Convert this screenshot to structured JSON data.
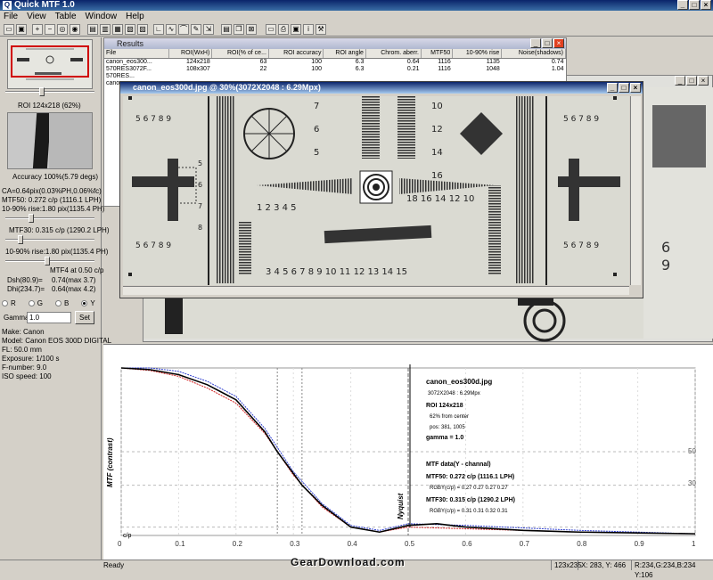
{
  "app": {
    "title": "Quick MTF 1.0"
  },
  "menu": [
    "File",
    "View",
    "Table",
    "Window",
    "Help"
  ],
  "left": {
    "roi_label": "ROI 124x218 (62%)",
    "accuracy": "Accuracy 100%(5.79 degs)",
    "ca": "CA=0.64pix(0.03%PH,0.06%fc)",
    "mtf50": "MTF50: 0.272 c/p (1116.1 LPH)",
    "rise1": "10-90% rise:1.80 pix(1135.4 PH)",
    "mtf30": "MTF30: 0.315 c/p (1290.2 LPH)",
    "rise2": "10-90% rise:1.80 pix(1135.4 PH)",
    "mtf4": "MTF4 at 0.50 c/p",
    "dsh_label": "Dsh(80.9)=",
    "dsh_value": "0.74(max 3.7)",
    "dhi_label": "Dhi(234.7)=",
    "dhi_value": "0.64(max 4.2)",
    "channels": [
      "R",
      "G",
      "B",
      "Y"
    ],
    "gamma_label": "Gamma:",
    "gamma_value": "1.0",
    "set_label": "Set",
    "exif": [
      "Make: Canon",
      "Model: Canon EOS 300D DIGITAL",
      "FL: 50.0 mm",
      "Exposure: 1/100 s",
      "F-number: 9.0",
      "ISO speed: 100"
    ]
  },
  "results": {
    "title": "Results",
    "columns": [
      "File",
      "ROI(WxH)",
      "ROI(% of ce...",
      "ROI accuracy",
      "ROI angle",
      "Chrom. aberr.",
      "MTF50",
      "10-90% rise",
      "Noise(shadows)"
    ],
    "rows": [
      [
        "canon_eos300...",
        "124x218",
        "63",
        "100",
        "6.3",
        "0.64",
        "1116",
        "1135",
        "0.74"
      ],
      [
        "570RES3072F...",
        "108x307",
        "22",
        "100",
        "6.3",
        "0.21",
        "1116",
        "1048",
        "1.04"
      ],
      [
        "570RES...",
        "",
        "",
        "",
        "",
        "",
        "",
        "",
        ""
      ],
      [
        "canon...",
        "",
        "",
        "",
        "",
        "",
        "",
        "",
        ""
      ]
    ]
  },
  "imagewin": {
    "title": "canon_eos300d.jpg @ 30%(3072X2048 : 6.29Mpx)"
  },
  "plot": {
    "ylabel": "MTF (contrast)",
    "nyquist": "Nyquist",
    "cp_label": "c/p",
    "side_labels": [
      "50",
      "30"
    ],
    "info": {
      "file": "canon_eos300d.jpg",
      "dims": "3072X2048 : 6.29Mpx",
      "roi": "ROI 124x218",
      "center": "62% from center",
      "pos": "pos: 381, 1005",
      "gamma": "gamma = 1.0",
      "mtf_title": "MTF data(Y - channal)",
      "mtf50": "MTF50: 0.272 c/p (1116.1 LPH)",
      "rgby50": "RGBY(c/p) = 0.27 0.27 0.27 0.27",
      "mtf30": "MTF30: 0.315 c/p (1290.2 LPH)",
      "rgby30": "RGBY(c/p) = 0.31 0.31 0.32 0.31"
    }
  },
  "chart_data": {
    "type": "line",
    "xlabel": "c/p",
    "ylabel": "MTF (contrast)",
    "xlim": [
      0,
      1.0
    ],
    "ylim": [
      0,
      1.0
    ],
    "x_ticks": [
      "0",
      "0.1",
      "0.2",
      "0.3",
      "0.4",
      "0.5",
      "0.6",
      "0.7",
      "0.8",
      "0.9",
      "1"
    ],
    "series": [
      {
        "color": "#000000",
        "x": [
          0,
          0.05,
          0.1,
          0.15,
          0.2,
          0.25,
          0.272,
          0.3,
          0.315,
          0.35,
          0.4,
          0.45,
          0.5,
          0.55,
          0.6,
          0.7,
          0.8,
          0.9,
          1.0
        ],
        "y": [
          1.0,
          0.99,
          0.96,
          0.9,
          0.81,
          0.62,
          0.5,
          0.37,
          0.3,
          0.18,
          0.05,
          0.02,
          0.06,
          0.07,
          0.05,
          0.03,
          0.02,
          0.015,
          0.01
        ]
      },
      {
        "color": "#d02020",
        "x": [
          0,
          0.05,
          0.1,
          0.15,
          0.2,
          0.25,
          0.3,
          0.35,
          0.4,
          0.45,
          0.5,
          0.6,
          0.8,
          1.0
        ],
        "y": [
          1.0,
          0.985,
          0.95,
          0.88,
          0.79,
          0.61,
          0.36,
          0.17,
          0.05,
          0.02,
          0.05,
          0.04,
          0.02,
          0.01
        ]
      },
      {
        "color": "#3040d0",
        "x": [
          0,
          0.05,
          0.1,
          0.15,
          0.2,
          0.25,
          0.3,
          0.35,
          0.4,
          0.45,
          0.5,
          0.6,
          0.8,
          1.0
        ],
        "y": [
          1.0,
          1.0,
          0.98,
          0.92,
          0.83,
          0.64,
          0.38,
          0.19,
          0.06,
          0.03,
          0.07,
          0.06,
          0.03,
          0.01
        ]
      }
    ],
    "mtf50_x": 0.272,
    "mtf30_x": 0.315,
    "nyquist_x": 0.5,
    "grid": true
  },
  "status": {
    "ready": "Ready",
    "size": "123x235",
    "coords": "X: 283, Y: 466",
    "rgb": "R:234,G:234,B:234 Y:106"
  },
  "watermark": "GearDownload.com"
}
